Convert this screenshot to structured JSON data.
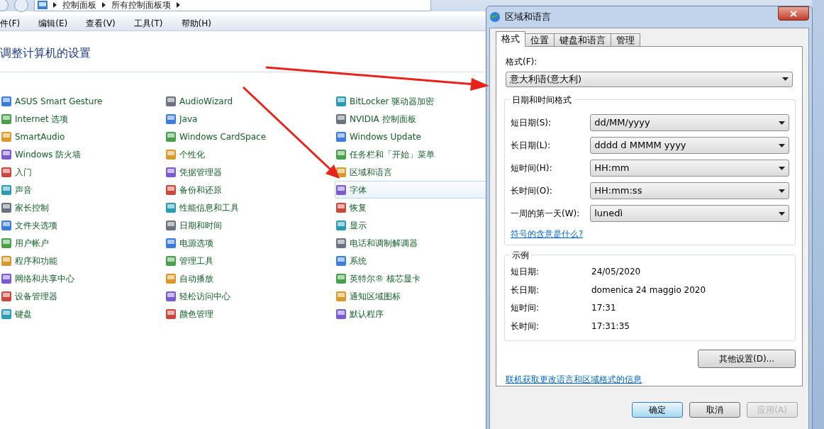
{
  "explorer": {
    "breadcrumb": [
      "控制面板",
      "所有控制面板项"
    ],
    "menu": [
      "件(F)",
      "编辑(E)",
      "查看(V)",
      "工具(T)",
      "帮助(H)"
    ],
    "heading": "调整计算机的设置",
    "columns": [
      [
        {
          "label": "ASUS Smart Gesture",
          "selected": false
        },
        {
          "label": "Internet 选项",
          "selected": false
        },
        {
          "label": "SmartAudio",
          "selected": false
        },
        {
          "label": "Windows 防火墙",
          "selected": false
        },
        {
          "label": "入门",
          "selected": false
        },
        {
          "label": "声音",
          "selected": false
        },
        {
          "label": "家长控制",
          "selected": false
        },
        {
          "label": "文件夹选项",
          "selected": false
        },
        {
          "label": "用户帐户",
          "selected": false
        },
        {
          "label": "程序和功能",
          "selected": false
        },
        {
          "label": "网络和共享中心",
          "selected": false
        },
        {
          "label": "设备管理器",
          "selected": false
        },
        {
          "label": "键盘",
          "selected": false
        }
      ],
      [
        {
          "label": "AudioWizard",
          "selected": false
        },
        {
          "label": "Java",
          "selected": false
        },
        {
          "label": "Windows CardSpace",
          "selected": false
        },
        {
          "label": "个性化",
          "selected": false
        },
        {
          "label": "凭据管理器",
          "selected": false
        },
        {
          "label": "备份和还原",
          "selected": false
        },
        {
          "label": "性能信息和工具",
          "selected": false
        },
        {
          "label": "日期和时间",
          "selected": false
        },
        {
          "label": "电源选项",
          "selected": false
        },
        {
          "label": "管理工具",
          "selected": false
        },
        {
          "label": "自动播放",
          "selected": false
        },
        {
          "label": "轻松访问中心",
          "selected": false
        },
        {
          "label": "颜色管理",
          "selected": false
        }
      ],
      [
        {
          "label": "BitLocker 驱动器加密",
          "selected": false
        },
        {
          "label": "NVIDIA 控制面板",
          "selected": false
        },
        {
          "label": "Windows Update",
          "selected": false
        },
        {
          "label": "任务栏和「开始」菜单",
          "selected": false
        },
        {
          "label": "区域和语言",
          "selected": false
        },
        {
          "label": "字体",
          "selected": true
        },
        {
          "label": "恢复",
          "selected": false
        },
        {
          "label": "显示",
          "selected": false
        },
        {
          "label": "电话和调制解调器",
          "selected": false
        },
        {
          "label": "系统",
          "selected": false
        },
        {
          "label": "英特尔® 核芯显卡",
          "selected": false
        },
        {
          "label": "通知区域图标",
          "selected": false
        },
        {
          "label": "默认程序",
          "selected": false
        }
      ]
    ]
  },
  "dialog": {
    "title": "区域和语言",
    "tabs": [
      {
        "label": "格式",
        "selected": true
      },
      {
        "label": "位置",
        "selected": false
      },
      {
        "label": "键盘和语言",
        "selected": false
      },
      {
        "label": "管理",
        "selected": false
      }
    ],
    "format_label": "格式(F):",
    "format_value": "意大利语(意大利)",
    "datetime_group": {
      "title": "日期和时间格式",
      "rows": [
        {
          "label": "短日期(S):",
          "value": "dd/MM/yyyy"
        },
        {
          "label": "长日期(L):",
          "value": "dddd d MMMM yyyy"
        },
        {
          "label": "短时间(H):",
          "value": "HH:mm"
        },
        {
          "label": "长时间(O):",
          "value": "HH:mm:ss"
        },
        {
          "label": "一周的第一天(W):",
          "value": "lunedì"
        }
      ]
    },
    "symbol_link": "符号的含意是什么?",
    "example_group": {
      "title": "示例",
      "rows": [
        {
          "label": "短日期:",
          "value": "24/05/2020"
        },
        {
          "label": "长日期:",
          "value": "domenica 24 maggio 2020"
        },
        {
          "label": "短时间:",
          "value": "17:31"
        },
        {
          "label": "长时间:",
          "value": "17:31:35"
        }
      ]
    },
    "more_button": "其他设置(D)...",
    "online_link": "联机获取更改语言和区域格式的信息",
    "buttons": [
      {
        "label": "确定",
        "kind": "default",
        "disabled": false
      },
      {
        "label": "取消",
        "kind": "normal",
        "disabled": false
      },
      {
        "label": "应用(A)",
        "kind": "normal",
        "disabled": true
      }
    ]
  }
}
